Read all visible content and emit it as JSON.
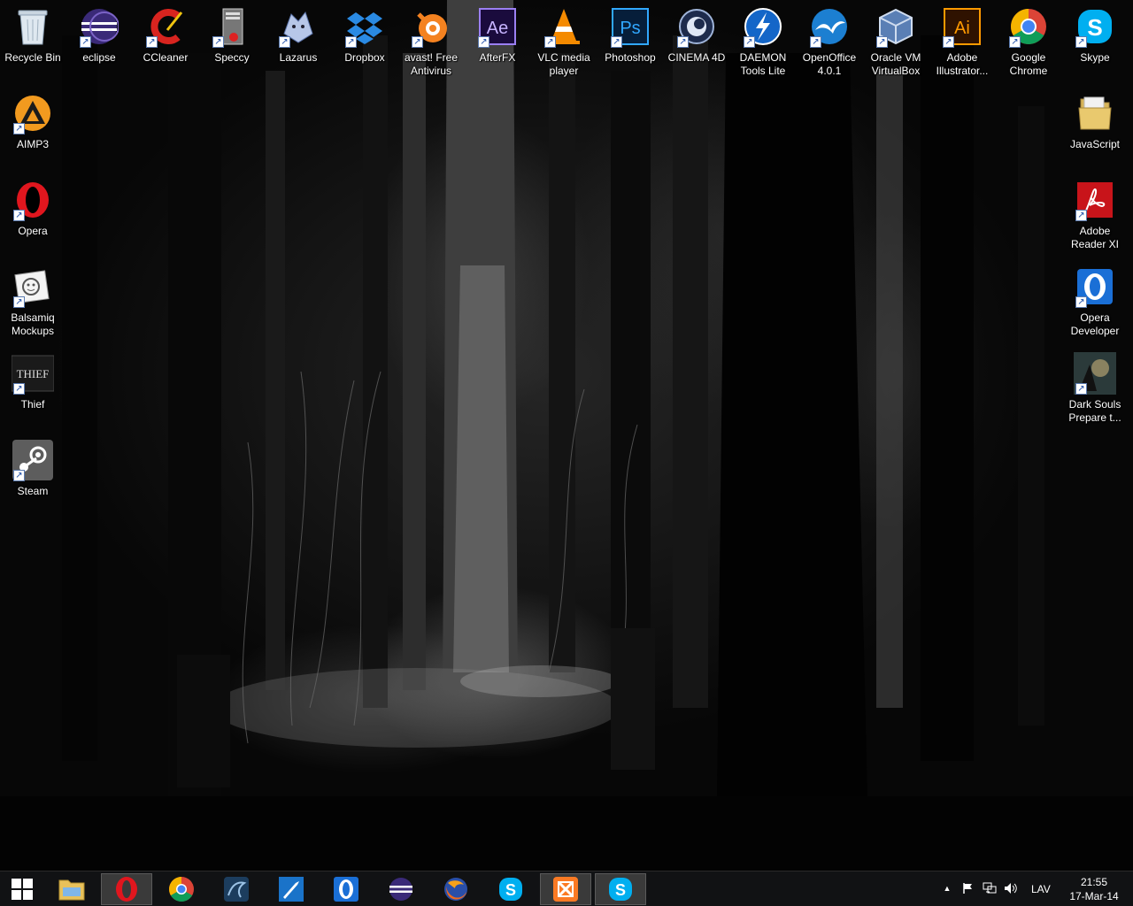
{
  "desktop": {
    "top_row": [
      {
        "id": "recycle-bin",
        "label": "Recycle Bin"
      },
      {
        "id": "eclipse",
        "label": "eclipse"
      },
      {
        "id": "ccleaner",
        "label": "CCleaner"
      },
      {
        "id": "speccy",
        "label": "Speccy"
      },
      {
        "id": "lazarus",
        "label": "Lazarus"
      },
      {
        "id": "dropbox",
        "label": "Dropbox"
      },
      {
        "id": "avast",
        "label": "avast! Free\nAntivirus"
      },
      {
        "id": "afterfx",
        "label": "AfterFX"
      },
      {
        "id": "vlc",
        "label": "VLC media\nplayer"
      },
      {
        "id": "photoshop",
        "label": "Photoshop"
      },
      {
        "id": "cinema4d",
        "label": "CINEMA 4D"
      },
      {
        "id": "daemon-tools",
        "label": "DAEMON\nTools Lite"
      },
      {
        "id": "openoffice",
        "label": "OpenOffice\n4.0.1"
      },
      {
        "id": "virtualbox",
        "label": "Oracle VM\nVirtualBox"
      },
      {
        "id": "illustrator",
        "label": "Adobe\nIllustrator..."
      },
      {
        "id": "chrome",
        "label": "Google\nChrome"
      },
      {
        "id": "skype",
        "label": "Skype"
      }
    ],
    "left_column": [
      {
        "id": "aimp3",
        "label": "AIMP3"
      },
      {
        "id": "opera",
        "label": "Opera"
      },
      {
        "id": "balsamiq",
        "label": "Balsamiq\nMockups"
      },
      {
        "id": "thief",
        "label": "Thief"
      },
      {
        "id": "steam",
        "label": "Steam"
      }
    ],
    "right_column": [
      {
        "id": "javascript-folder",
        "label": "JavaScript"
      },
      {
        "id": "adobe-reader",
        "label": "Adobe\nReader XI"
      },
      {
        "id": "opera-developer",
        "label": "Opera\nDeveloper"
      },
      {
        "id": "dark-souls",
        "label": "Dark Souls\nPrepare t..."
      }
    ]
  },
  "taskbar": {
    "start_icon": "windows-start-icon",
    "pinned": [
      {
        "id": "file-explorer",
        "active": false
      },
      {
        "id": "opera",
        "active": true
      },
      {
        "id": "chrome",
        "active": false
      },
      {
        "id": "mysql-workbench",
        "active": false
      },
      {
        "id": "visual-studio",
        "active": false
      },
      {
        "id": "opera-developer",
        "active": false
      },
      {
        "id": "eclipse",
        "active": false
      },
      {
        "id": "firefox",
        "active": false
      },
      {
        "id": "skype",
        "active": false
      },
      {
        "id": "xampp",
        "active": true
      },
      {
        "id": "skype-running",
        "active": true
      }
    ],
    "tray": {
      "show_hidden": "▲",
      "language": "LAV",
      "time": "21:55",
      "date": "17-Mar-14"
    }
  },
  "colors": {
    "taskbar_bg": "#111214",
    "active_item_bg": "#3a3a3a"
  }
}
